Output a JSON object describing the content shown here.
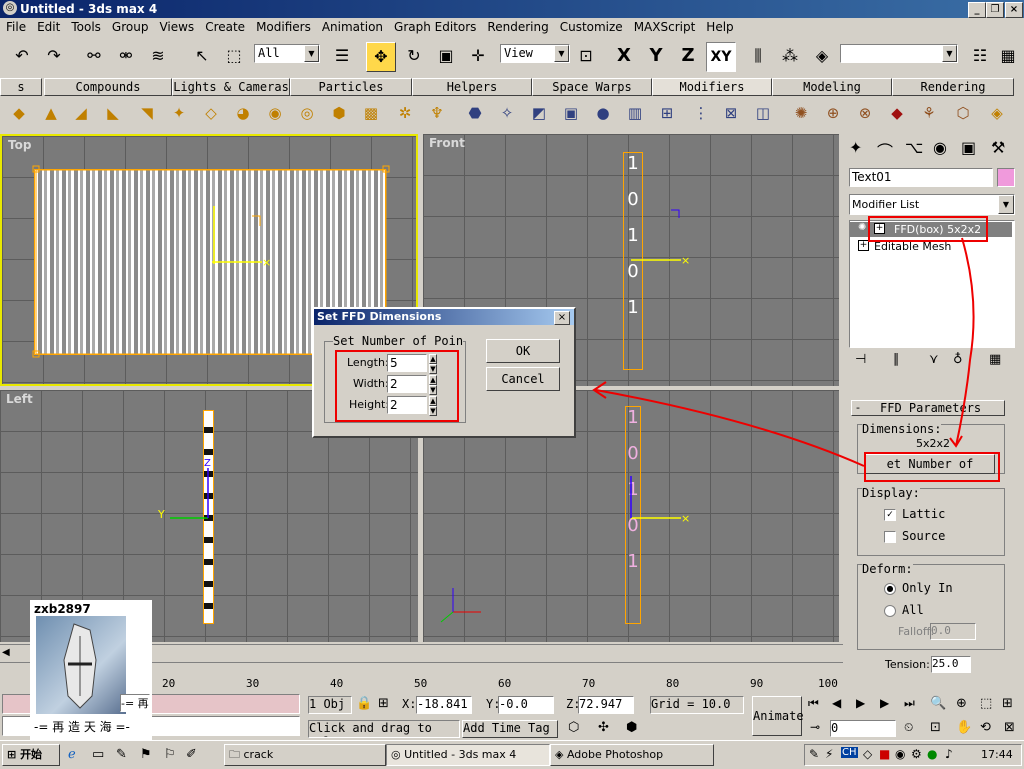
{
  "window": {
    "title": "Untitled - 3ds max 4",
    "min_btn": "_",
    "restore_btn": "❐",
    "close_btn": "×"
  },
  "menu": [
    "File",
    "Edit",
    "Tools",
    "Group",
    "Views",
    "Create",
    "Modifiers",
    "Animation",
    "Graph Editors",
    "Rendering",
    "Customize",
    "MAXScript",
    "Help"
  ],
  "toolbar": {
    "selection_filter": "All",
    "ref_coord": "View",
    "axes": [
      "X",
      "Y",
      "Z",
      "XY"
    ]
  },
  "tabs": [
    "s",
    "Compounds",
    "Lights & Cameras",
    "Particles",
    "Helpers",
    "Space Warps",
    "Modifiers",
    "Modeling",
    "Rendering"
  ],
  "viewports": {
    "top": "Top",
    "front": "Front",
    "left": "Left"
  },
  "dialog": {
    "title": "Set FFD Dimensions",
    "group": "Set Number of Poin",
    "length_label": "Length:",
    "length_value": "5",
    "width_label": "Width:",
    "width_value": "2",
    "height_label": "Height:",
    "height_value": "2",
    "ok": "OK",
    "cancel": "Cancel",
    "close": "×"
  },
  "command_panel": {
    "object_name": "Text01",
    "modifier_list": "Modifier List",
    "stack": [
      "FFD(box) 5x2x2",
      "Editable Mesh"
    ],
    "rollout_title": "FFD Parameters",
    "dimensions_label": "Dimensions:",
    "dimensions_value": "5x2x2",
    "set_points_btn": "et Number of Point",
    "display_label": "Display:",
    "lattice": "Lattic",
    "source": "Source",
    "deform_label": "Deform:",
    "only_in": "Only In",
    "all": "All",
    "falloff_label": "Falloff:",
    "falloff_value": "0.0",
    "tension_label": "Tension:",
    "tension_value": "25.0"
  },
  "timeline": {
    "ticks": [
      "20",
      "30",
      "40",
      "50",
      "60",
      "70",
      "80",
      "90",
      "100"
    ]
  },
  "status": {
    "selected": "1 Obj",
    "x_label": "X:",
    "x": "-18.841",
    "y_label": "Y:",
    "y": "-0.0",
    "z_label": "Z:",
    "z": "72.947",
    "grid": "Grid = 10.0",
    "prompt": "Click and drag to sel",
    "add_time_tag": "Add Time Tag",
    "animate": "Animate",
    "frame": "0"
  },
  "overlay": {
    "user": "zxb2897",
    "caption": "-= 再 造 天 海 =-",
    "badge": "-= 再"
  },
  "taskbar": {
    "start": "开始",
    "items": [
      "crack",
      "Untitled - 3ds max 4",
      "Adobe Photoshop"
    ],
    "clock": "17:44",
    "tray_ch": "CH"
  },
  "text_layer": {
    "front_chars": [
      "1",
      "0",
      "1",
      "0",
      "1"
    ],
    "persp_chars": [
      "1",
      "0",
      "1",
      "0",
      "1"
    ]
  },
  "colors": {
    "title": "#0a246a",
    "viewport": "#7a7a7a",
    "selection": "#ffa500",
    "annotation": "#e00000"
  }
}
